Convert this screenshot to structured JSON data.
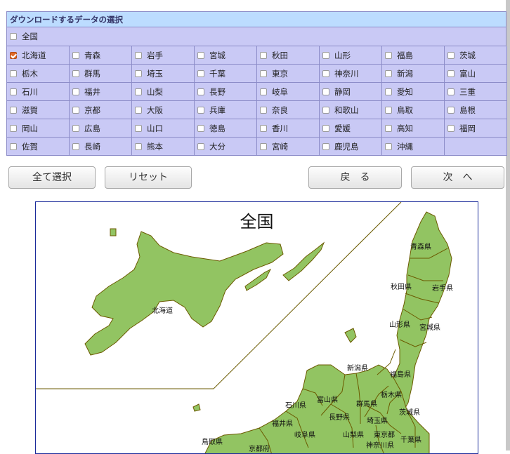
{
  "panel": {
    "title": "ダウンロードするデータの選択",
    "all_label": "全国",
    "prefectures": [
      {
        "name": "北海道",
        "checked": true
      },
      {
        "name": "青森"
      },
      {
        "name": "岩手"
      },
      {
        "name": "宮城"
      },
      {
        "name": "秋田"
      },
      {
        "name": "山形"
      },
      {
        "name": "福島"
      },
      {
        "name": "茨城"
      },
      {
        "name": "栃木"
      },
      {
        "name": "群馬"
      },
      {
        "name": "埼玉"
      },
      {
        "name": "千葉"
      },
      {
        "name": "東京"
      },
      {
        "name": "神奈川"
      },
      {
        "name": "新潟"
      },
      {
        "name": "富山"
      },
      {
        "name": "石川"
      },
      {
        "name": "福井"
      },
      {
        "name": "山梨"
      },
      {
        "name": "長野"
      },
      {
        "name": "岐阜"
      },
      {
        "name": "静岡"
      },
      {
        "name": "愛知"
      },
      {
        "name": "三重"
      },
      {
        "name": "滋賀"
      },
      {
        "name": "京都"
      },
      {
        "name": "大阪"
      },
      {
        "name": "兵庫"
      },
      {
        "name": "奈良"
      },
      {
        "name": "和歌山"
      },
      {
        "name": "鳥取"
      },
      {
        "name": "島根"
      },
      {
        "name": "岡山"
      },
      {
        "name": "広島"
      },
      {
        "name": "山口"
      },
      {
        "name": "徳島"
      },
      {
        "name": "香川"
      },
      {
        "name": "愛媛"
      },
      {
        "name": "高知"
      },
      {
        "name": "福岡"
      },
      {
        "name": "佐賀"
      },
      {
        "name": "長崎"
      },
      {
        "name": "熊本"
      },
      {
        "name": "大分"
      },
      {
        "name": "宮崎"
      },
      {
        "name": "鹿児島"
      },
      {
        "name": "沖縄"
      }
    ]
  },
  "buttons": {
    "select_all": "全て選択",
    "reset": "リセット",
    "back": "戻　る",
    "next": "次　へ"
  },
  "map": {
    "title": "全国",
    "land_color": "#92c462",
    "border_color": "#6b5a00",
    "labels": [
      {
        "id": "hokkaido",
        "text": "北海道"
      },
      {
        "id": "aomori",
        "text": "青森県"
      },
      {
        "id": "akita",
        "text": "秋田県"
      },
      {
        "id": "iwate",
        "text": "岩手県"
      },
      {
        "id": "yamagata",
        "text": "山形県"
      },
      {
        "id": "miyagi",
        "text": "宮城県"
      },
      {
        "id": "niigata",
        "text": "新潟県"
      },
      {
        "id": "fukushima",
        "text": "福島県"
      },
      {
        "id": "tochigi",
        "text": "栃木県"
      },
      {
        "id": "toyama",
        "text": "富山県"
      },
      {
        "id": "ishikawa",
        "text": "石川県"
      },
      {
        "id": "gunma",
        "text": "群馬県"
      },
      {
        "id": "ibaraki",
        "text": "茨城県"
      },
      {
        "id": "nagano",
        "text": "長野県"
      },
      {
        "id": "saitama",
        "text": "埼玉県"
      },
      {
        "id": "fukui",
        "text": "福井県"
      },
      {
        "id": "yamanashi",
        "text": "山梨県"
      },
      {
        "id": "tokyo",
        "text": "東京都"
      },
      {
        "id": "gifu",
        "text": "岐阜県"
      },
      {
        "id": "tottori",
        "text": "鳥取県"
      },
      {
        "id": "kyoto",
        "text": "京都府"
      },
      {
        "id": "kanagawa",
        "text": "神奈川県"
      },
      {
        "id": "chiba",
        "text": "千葉県"
      }
    ]
  }
}
